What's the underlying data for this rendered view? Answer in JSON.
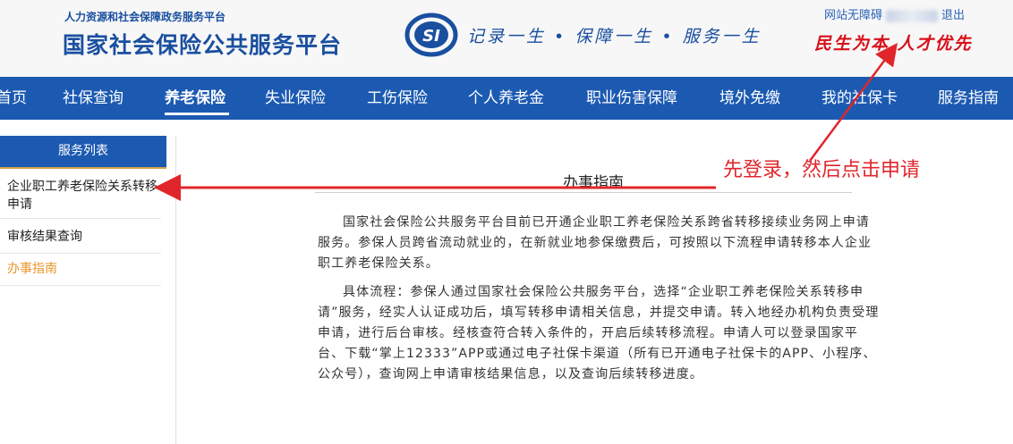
{
  "header": {
    "ministry": "人力资源和社会保障政务服务平台",
    "platform_title": "国家社会保险公共服务平台",
    "logo_text": "SI",
    "slogan": "记录一生 • 保障一生 • 服务一生",
    "motto": "民生为本 人才优先",
    "accessibility_link": "网站无障碍",
    "logout_link": "退出"
  },
  "nav": {
    "items": [
      {
        "label": "首页"
      },
      {
        "label": "社保查询"
      },
      {
        "label": "养老保险",
        "active": true
      },
      {
        "label": "失业保险"
      },
      {
        "label": "工伤保险"
      },
      {
        "label": "个人养老金"
      },
      {
        "label": "职业伤害保障"
      },
      {
        "label": "境外免缴"
      },
      {
        "label": "我的社保卡"
      },
      {
        "label": "服务指南"
      }
    ]
  },
  "sidebar": {
    "heading": "服务列表",
    "items": [
      {
        "label": "企业职工养老保险关系转移申请"
      },
      {
        "label": "审核结果查询"
      },
      {
        "label": "办事指南",
        "active": true
      }
    ]
  },
  "content": {
    "title": "办事指南",
    "paragraphs": [
      "国家社会保险公共服务平台目前已开通企业职工养老保险关系跨省转移接续业务网上申请服务。参保人员跨省流动就业的，在新就业地参保缴费后，可按照以下流程申请转移本人企业职工养老保险关系。",
      "具体流程：参保人通过国家社会保险公共服务平台，选择“企业职工养老保险关系转移申请”服务，经实人认证成功后，填写转移申请相关信息，并提交申请。转入地经办机构负责受理申请，进行后台审核。经核查符合转入条件的，开启后续转移流程。申请人可以登录国家平台、下载“掌上12333”APP或通过电子社保卡渠道（所有已开通电子社保卡的APP、小程序、公众号），查询网上申请审核结果信息，以及查询后续转移进度。"
    ]
  },
  "annotation": {
    "text": "先登录，然后点击申请"
  },
  "colors": {
    "brand_blue": "#1c5ab2",
    "annotation_red": "#e0262b",
    "active_orange": "#e8962a",
    "motto_red": "#d8101a"
  }
}
